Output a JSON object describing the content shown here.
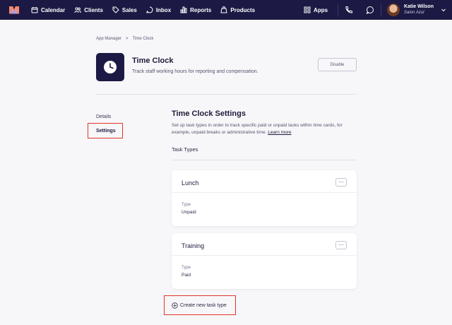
{
  "nav": {
    "items": [
      {
        "label": "Calendar",
        "icon": "calendar-icon"
      },
      {
        "label": "Clients",
        "icon": "clients-icon"
      },
      {
        "label": "Sales",
        "icon": "sales-icon"
      },
      {
        "label": "Inbox",
        "icon": "inbox-icon"
      },
      {
        "label": "Reports",
        "icon": "reports-icon"
      },
      {
        "label": "Products",
        "icon": "products-icon"
      }
    ],
    "apps_label": "Apps",
    "user": {
      "name": "Katie Wilson",
      "salon": "Salon Azul"
    },
    "colors": {
      "bar": "#1c1a44",
      "accent_red": "#e0352b"
    }
  },
  "breadcrumb": {
    "root": "App Manager",
    "separator": ">",
    "current": "Time Clock"
  },
  "app": {
    "title": "Time Clock",
    "subtitle": "Track staff working hours for reporting and compensation.",
    "disable_label": "Disable"
  },
  "tabs": {
    "details": "Details",
    "settings": "Settings",
    "selected": "Settings"
  },
  "settings": {
    "title": "Time Clock Settings",
    "description": "Set up task types in order to track specific paid or unpaid tasks within time cards, for example, unpaid breaks or administrative time.",
    "learn_more": "Learn more",
    "task_types_label": "Task Types",
    "type_label": "Type",
    "tasks": [
      {
        "name": "Lunch",
        "type": "Unpaid"
      },
      {
        "name": "Training",
        "type": "Paid"
      }
    ],
    "more_label": "···",
    "create_label": "Create new task type"
  }
}
